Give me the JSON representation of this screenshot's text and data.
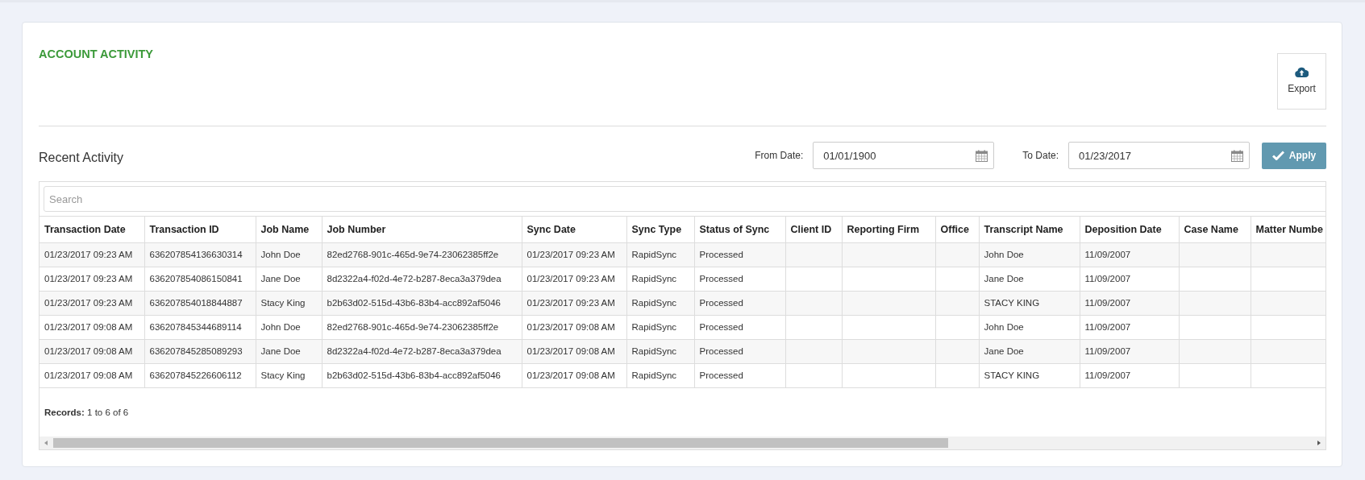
{
  "title": "ACCOUNT ACTIVITY",
  "export_button": {
    "label": "Export"
  },
  "section_title": "Recent Activity",
  "filters": [
    {
      "label": "From Date:",
      "value": "01/01/1900"
    },
    {
      "label": "To Date:",
      "value": "01/23/2017"
    }
  ],
  "apply_button": {
    "label": "Apply"
  },
  "search": {
    "placeholder": "Search"
  },
  "table": {
    "columns": [
      "Transaction Date",
      "Transaction ID",
      "Job Name",
      "Job Number",
      "Sync Date",
      "Sync Type",
      "Status of Sync",
      "Client ID",
      "Reporting Firm",
      "Office",
      "Transcript Name",
      "Deposition Date",
      "Case Name",
      "Matter Numbe"
    ],
    "rows": [
      {
        "transaction_date": "01/23/2017 09:23 AM",
        "transaction_id": "636207854136630314",
        "job_name": "John Doe",
        "job_number": "82ed2768-901c-465d-9e74-23062385ff2e",
        "sync_date": "01/23/2017 09:23 AM",
        "sync_type": "RapidSync",
        "status_of_sync": "Processed",
        "transcript_name": "John Doe",
        "deposition_date": "11/09/2007"
      },
      {
        "transaction_date": "01/23/2017 09:23 AM",
        "transaction_id": "636207854086150841",
        "job_name": "Jane Doe",
        "job_number": "8d2322a4-f02d-4e72-b287-8eca3a379dea",
        "sync_date": "01/23/2017 09:23 AM",
        "sync_type": "RapidSync",
        "status_of_sync": "Processed",
        "transcript_name": "Jane Doe",
        "deposition_date": "11/09/2007"
      },
      {
        "transaction_date": "01/23/2017 09:23 AM",
        "transaction_id": "636207854018844887",
        "job_name": "Stacy King",
        "job_number": "b2b63d02-515d-43b6-83b4-acc892af5046",
        "sync_date": "01/23/2017 09:23 AM",
        "sync_type": "RapidSync",
        "status_of_sync": "Processed",
        "transcript_name": "STACY KING",
        "deposition_date": "11/09/2007"
      },
      {
        "transaction_date": "01/23/2017 09:08 AM",
        "transaction_id": "636207845344689114",
        "job_name": "John Doe",
        "job_number": "82ed2768-901c-465d-9e74-23062385ff2e",
        "sync_date": "01/23/2017 09:08 AM",
        "sync_type": "RapidSync",
        "status_of_sync": "Processed",
        "transcript_name": "John Doe",
        "deposition_date": "11/09/2007"
      },
      {
        "transaction_date": "01/23/2017 09:08 AM",
        "transaction_id": "636207845285089293",
        "job_name": "Jane Doe",
        "job_number": "8d2322a4-f02d-4e72-b287-8eca3a379dea",
        "sync_date": "01/23/2017 09:08 AM",
        "sync_type": "RapidSync",
        "status_of_sync": "Processed",
        "transcript_name": "Jane Doe",
        "deposition_date": "11/09/2007"
      },
      {
        "transaction_date": "01/23/2017 09:08 AM",
        "transaction_id": "636207845226606112",
        "job_name": "Stacy King",
        "job_number": "b2b63d02-515d-43b6-83b4-acc892af5046",
        "sync_date": "01/23/2017 09:08 AM",
        "sync_type": "RapidSync",
        "status_of_sync": "Processed",
        "transcript_name": "STACY KING",
        "deposition_date": "11/09/2007"
      }
    ]
  },
  "records": "**Records:** 1 to 6 of 6"
}
